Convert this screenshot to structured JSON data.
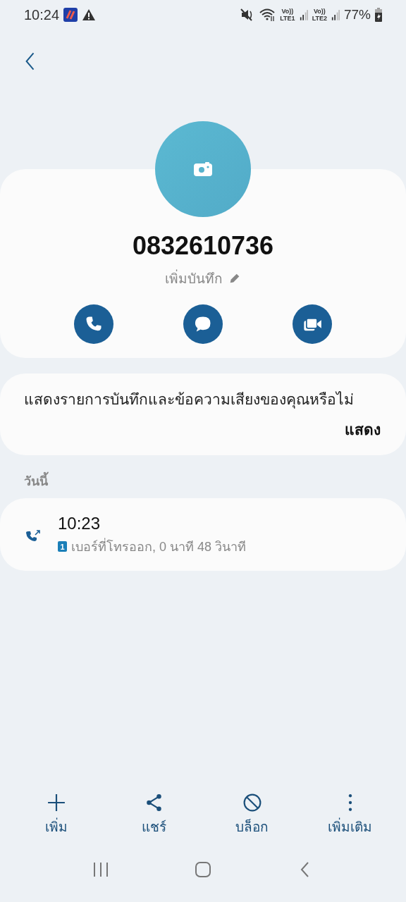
{
  "status_bar": {
    "time": "10:24",
    "sims": [
      {
        "volte": "Vo))",
        "network": "LTE1"
      },
      {
        "volte": "Vo))",
        "network": "LTE2"
      }
    ],
    "battery": "77%"
  },
  "contact": {
    "number": "0832610736",
    "note_label": "เพิ่มบันทึก",
    "actions": [
      {
        "kind": "call"
      },
      {
        "kind": "message"
      },
      {
        "kind": "video"
      }
    ]
  },
  "recordings_prompt": {
    "text": "แสดงรายการบันทึกและข้อความเสียงของคุณหรือไม่",
    "button": "แสดง"
  },
  "section_title": "วันนี้",
  "calls": [
    {
      "kind": "outgoing",
      "time": "10:23",
      "sim": "1",
      "detail": "เบอร์ที่โทรออก, 0 นาที 48 วินาที"
    }
  ],
  "bottom_actions": [
    {
      "kind": "add",
      "label": "เพิ่ม"
    },
    {
      "kind": "share",
      "label": "แชร์"
    },
    {
      "kind": "block",
      "label": "บล็อก"
    },
    {
      "kind": "more",
      "label": "เพิ่มเติม"
    }
  ]
}
